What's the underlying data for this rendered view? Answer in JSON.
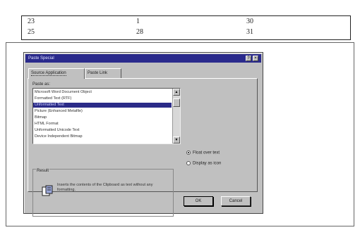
{
  "top_table": {
    "rows": [
      [
        "23",
        "1",
        "30"
      ],
      [
        "25",
        "28",
        "31"
      ]
    ]
  },
  "dialog": {
    "title": "Paste Special",
    "help_button": "?",
    "close_button": "×",
    "tabs": [
      {
        "label": "Source Application"
      },
      {
        "label": "Paste Link"
      }
    ],
    "as_label": "Paste as:",
    "list_items": [
      "Microsoft Word Document Object",
      "Formatted Text (RTF)",
      "Unformatted Text",
      "Picture (Enhanced Metafile)",
      "Bitmap",
      "HTML Format",
      "Unformatted Unicode Text",
      "Device Independent Bitmap"
    ],
    "selected_index": 2,
    "options": [
      {
        "label": "Float over text",
        "checked": true
      },
      {
        "label": "Display as icon",
        "checked": false
      }
    ],
    "result_label": "Result",
    "result_text": "Inserts the contents of the Clipboard as text without any formatting.",
    "ok_label": "OK",
    "cancel_label": "Cancel",
    "icon_name": "clipboard-result-icon",
    "colors": {
      "titlebar": "#2a2a8c",
      "dialog_face": "#c0c0c0",
      "selection": "#2b2b88"
    }
  }
}
